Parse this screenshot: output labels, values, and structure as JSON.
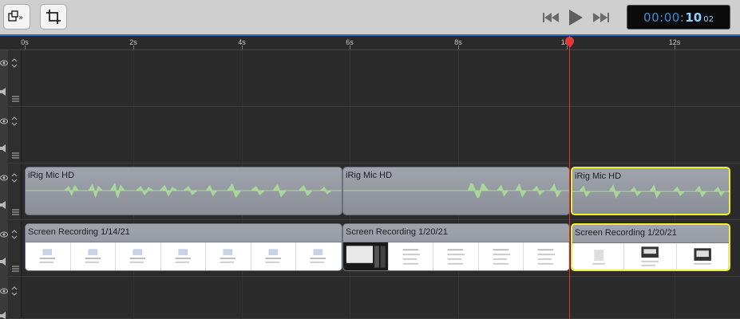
{
  "toolbar": {
    "left_buttons": [
      {
        "name": "pip-layout-button",
        "icon": "picture-in-picture-icon"
      },
      {
        "name": "crop-button",
        "icon": "crop-icon"
      }
    ],
    "transport": [
      {
        "name": "skip-back-button",
        "icon": "skip-back-icon"
      },
      {
        "name": "play-button",
        "icon": "play-icon"
      },
      {
        "name": "skip-forward-button",
        "icon": "skip-forward-icon"
      }
    ],
    "timecode": {
      "hm": "00:00:",
      "seconds": "10",
      "frames": "02"
    }
  },
  "ruler": {
    "ticks": [
      "0s",
      "2s",
      "4s",
      "6s",
      "8s",
      "10s",
      "12s"
    ]
  },
  "tracks": [
    {
      "type": "empty"
    },
    {
      "type": "empty"
    },
    {
      "type": "audio",
      "clips": [
        {
          "label": "iRig Mic HD",
          "selected": false
        },
        {
          "label": "iRig Mic HD",
          "selected": false
        },
        {
          "label": "iRig Mic HD",
          "selected": true
        }
      ]
    },
    {
      "type": "video",
      "clips": [
        {
          "label": "Screen Recording 1/14/21",
          "selected": false
        },
        {
          "label": "Screen Recording 1/20/21",
          "selected": false
        },
        {
          "label": "Screen Recording 1/20/21",
          "selected": true
        }
      ]
    },
    {
      "type": "empty"
    }
  ],
  "colors": {
    "accent": "#3a6cc7",
    "selection": "#f0ee2a",
    "playhead": "#e03030",
    "waveform": "#a8d898"
  }
}
